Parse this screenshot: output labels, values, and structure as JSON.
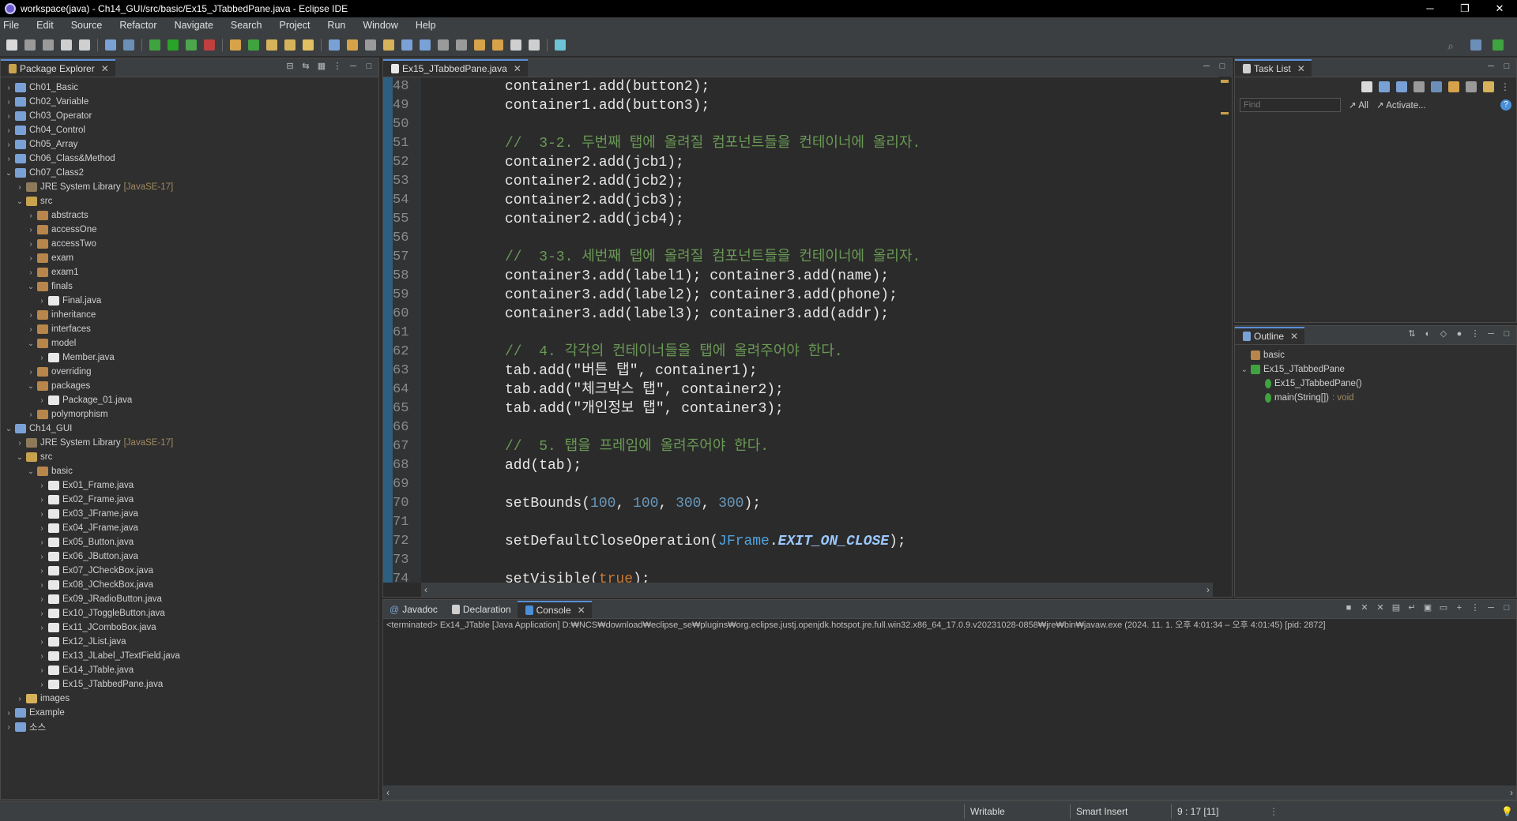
{
  "window": {
    "title": "workspace(java) - Ch14_GUI/src/basic/Ex15_JTabbedPane.java - Eclipse IDE",
    "min": "─",
    "max": "❐",
    "close": "✕"
  },
  "menu": [
    "File",
    "Edit",
    "Source",
    "Refactor",
    "Navigate",
    "Search",
    "Project",
    "Run",
    "Window",
    "Help"
  ],
  "package_explorer": {
    "title": "Package Explorer",
    "items": [
      {
        "indent": 0,
        "chev": "›",
        "icon": "proj",
        "label": "Ch01_Basic"
      },
      {
        "indent": 0,
        "chev": "›",
        "icon": "proj",
        "label": "Ch02_Variable"
      },
      {
        "indent": 0,
        "chev": "›",
        "icon": "proj",
        "label": "Ch03_Operator"
      },
      {
        "indent": 0,
        "chev": "›",
        "icon": "proj",
        "label": "Ch04_Control"
      },
      {
        "indent": 0,
        "chev": "›",
        "icon": "proj",
        "label": "Ch05_Array"
      },
      {
        "indent": 0,
        "chev": "›",
        "icon": "proj",
        "label": "Ch06_Class&Method"
      },
      {
        "indent": 0,
        "chev": "⌄",
        "icon": "proj",
        "label": "Ch07_Class2"
      },
      {
        "indent": 1,
        "chev": "›",
        "icon": "lib",
        "label": "JRE System Library",
        "dim": "[JavaSE-17]"
      },
      {
        "indent": 1,
        "chev": "⌄",
        "icon": "src",
        "label": "src"
      },
      {
        "indent": 2,
        "chev": "›",
        "icon": "pkg",
        "label": "abstracts"
      },
      {
        "indent": 2,
        "chev": "›",
        "icon": "pkg",
        "label": "accessOne"
      },
      {
        "indent": 2,
        "chev": "›",
        "icon": "pkg",
        "label": "accessTwo"
      },
      {
        "indent": 2,
        "chev": "›",
        "icon": "pkg",
        "label": "exam"
      },
      {
        "indent": 2,
        "chev": "›",
        "icon": "pkg",
        "label": "exam1"
      },
      {
        "indent": 2,
        "chev": "⌄",
        "icon": "pkg",
        "label": "finals"
      },
      {
        "indent": 3,
        "chev": "›",
        "icon": "file",
        "label": "Final.java"
      },
      {
        "indent": 2,
        "chev": "›",
        "icon": "pkg",
        "label": "inheritance"
      },
      {
        "indent": 2,
        "chev": "›",
        "icon": "pkg",
        "label": "interfaces"
      },
      {
        "indent": 2,
        "chev": "⌄",
        "icon": "pkg",
        "label": "model"
      },
      {
        "indent": 3,
        "chev": "›",
        "icon": "file",
        "label": "Member.java"
      },
      {
        "indent": 2,
        "chev": "›",
        "icon": "pkg",
        "label": "overriding"
      },
      {
        "indent": 2,
        "chev": "⌄",
        "icon": "pkg",
        "label": "packages"
      },
      {
        "indent": 3,
        "chev": "›",
        "icon": "file",
        "label": "Package_01.java"
      },
      {
        "indent": 2,
        "chev": "›",
        "icon": "pkg",
        "label": "polymorphism"
      },
      {
        "indent": 0,
        "chev": "⌄",
        "icon": "proj",
        "label": "Ch14_GUI"
      },
      {
        "indent": 1,
        "chev": "›",
        "icon": "lib",
        "label": "JRE System Library",
        "dim": "[JavaSE-17]"
      },
      {
        "indent": 1,
        "chev": "⌄",
        "icon": "src",
        "label": "src"
      },
      {
        "indent": 2,
        "chev": "⌄",
        "icon": "pkg",
        "label": "basic"
      },
      {
        "indent": 3,
        "chev": "›",
        "icon": "file",
        "label": "Ex01_Frame.java"
      },
      {
        "indent": 3,
        "chev": "›",
        "icon": "file",
        "label": "Ex02_Frame.java"
      },
      {
        "indent": 3,
        "chev": "›",
        "icon": "file",
        "label": "Ex03_JFrame.java"
      },
      {
        "indent": 3,
        "chev": "›",
        "icon": "file",
        "label": "Ex04_JFrame.java"
      },
      {
        "indent": 3,
        "chev": "›",
        "icon": "file",
        "label": "Ex05_Button.java"
      },
      {
        "indent": 3,
        "chev": "›",
        "icon": "file",
        "label": "Ex06_JButton.java"
      },
      {
        "indent": 3,
        "chev": "›",
        "icon": "file",
        "label": "Ex07_JCheckBox.java"
      },
      {
        "indent": 3,
        "chev": "›",
        "icon": "file",
        "label": "Ex08_JCheckBox.java"
      },
      {
        "indent": 3,
        "chev": "›",
        "icon": "file",
        "label": "Ex09_JRadioButton.java"
      },
      {
        "indent": 3,
        "chev": "›",
        "icon": "file",
        "label": "Ex10_JToggleButton.java"
      },
      {
        "indent": 3,
        "chev": "›",
        "icon": "file",
        "label": "Ex11_JComboBox.java"
      },
      {
        "indent": 3,
        "chev": "›",
        "icon": "file",
        "label": "Ex12_JList.java"
      },
      {
        "indent": 3,
        "chev": "›",
        "icon": "file",
        "label": "Ex13_JLabel_JTextField.java"
      },
      {
        "indent": 3,
        "chev": "›",
        "icon": "file",
        "label": "Ex14_JTable.java"
      },
      {
        "indent": 3,
        "chev": "›",
        "icon": "file",
        "label": "Ex15_JTabbedPane.java"
      },
      {
        "indent": 1,
        "chev": "›",
        "icon": "folder",
        "label": "images"
      },
      {
        "indent": 0,
        "chev": "›",
        "icon": "proj",
        "label": "Example"
      },
      {
        "indent": 0,
        "chev": "›",
        "icon": "proj",
        "label": "소스"
      }
    ]
  },
  "editor": {
    "tab": "Ex15_JTabbedPane.java",
    "lines": [
      {
        "n": "48",
        "html": "container1.add(button2);"
      },
      {
        "n": "49",
        "html": "container1.add(button3);"
      },
      {
        "n": "50",
        "html": ""
      },
      {
        "n": "51",
        "html": "<span class='cm'>//  3-2. 두번째 탭에 올려질 컴포넌트들을 컨테이너에 올리자.</span>"
      },
      {
        "n": "52",
        "html": "container2.add(jcb1);"
      },
      {
        "n": "53",
        "html": "container2.add(jcb2);"
      },
      {
        "n": "54",
        "html": "container2.add(jcb3);"
      },
      {
        "n": "55",
        "html": "container2.add(jcb4);"
      },
      {
        "n": "56",
        "html": ""
      },
      {
        "n": "57",
        "html": "<span class='cm'>//  3-3. 세번째 탭에 올려질 컴포넌트들을 컨테이너에 올리자.</span>"
      },
      {
        "n": "58",
        "html": "container3.add(label1); container3.add(name);"
      },
      {
        "n": "59",
        "html": "container3.add(label2); container3.add(phone);"
      },
      {
        "n": "60",
        "html": "container3.add(label3); container3.add(addr);"
      },
      {
        "n": "61",
        "html": ""
      },
      {
        "n": "62",
        "html": "<span class='cm'>//  4. 각각의 컨테이너들을 탭에 올려주어야 한다.</span>"
      },
      {
        "n": "63",
        "html": "tab.add(\"버튼 탭\", container1);"
      },
      {
        "n": "64",
        "html": "tab.add(\"체크박스 탭\", container2);"
      },
      {
        "n": "65",
        "html": "tab.add(\"개인정보 탭\", container3);"
      },
      {
        "n": "66",
        "html": ""
      },
      {
        "n": "67",
        "html": "<span class='cm'>//  5. 탭을 프레임에 올려주어야 한다.</span>"
      },
      {
        "n": "68",
        "html": "add(tab);"
      },
      {
        "n": "69",
        "html": ""
      },
      {
        "n": "70",
        "html": "setBounds(<span class='num'>100</span>, <span class='num'>100</span>, <span class='num'>300</span>, <span class='num'>300</span>);"
      },
      {
        "n": "71",
        "html": ""
      },
      {
        "n": "72",
        "html": "setDefaultCloseOperation(<span class='cls'>JFrame</span>.<span class='cst'>EXIT_ON_CLOSE</span>);"
      },
      {
        "n": "73",
        "html": ""
      },
      {
        "n": "74",
        "html": "setVisible(<span class='kw'>true</span>);"
      }
    ]
  },
  "tasklist": {
    "title": "Task List",
    "find_placeholder": "Find",
    "all": "All",
    "activate": "Activate..."
  },
  "outline": {
    "title": "Outline",
    "items": [
      {
        "indent": 0,
        "chev": "",
        "label": "basic",
        "extra": ""
      },
      {
        "indent": 0,
        "chev": "⌄",
        "label": "Ex15_JTabbedPane",
        "extra": ""
      },
      {
        "indent": 1,
        "chev": "",
        "label": "Ex15_JTabbedPane()",
        "extra": ""
      },
      {
        "indent": 1,
        "chev": "",
        "label": "main(String[])",
        "extra": ": void"
      }
    ]
  },
  "bottom_tabs": [
    "Javadoc",
    "Declaration",
    "Console"
  ],
  "console": {
    "info": "<terminated> Ex14_JTable [Java Application] D:₩NCS₩download₩eclipse_se₩plugins₩org.eclipse.justj.openjdk.hotspot.jre.full.win32.x86_64_17.0.9.v20231028-0858₩jre₩bin₩javaw.exe  (2024. 11. 1. 오후 4:01:34 – 오후 4:01:45) [pid: 2872]"
  },
  "status": {
    "writable": "Writable",
    "insert": "Smart Insert",
    "position": "9 : 17 [11]"
  },
  "colors": {
    "comment": "#6a9955",
    "number": "#6897bb",
    "keyword": "#cc7832"
  }
}
